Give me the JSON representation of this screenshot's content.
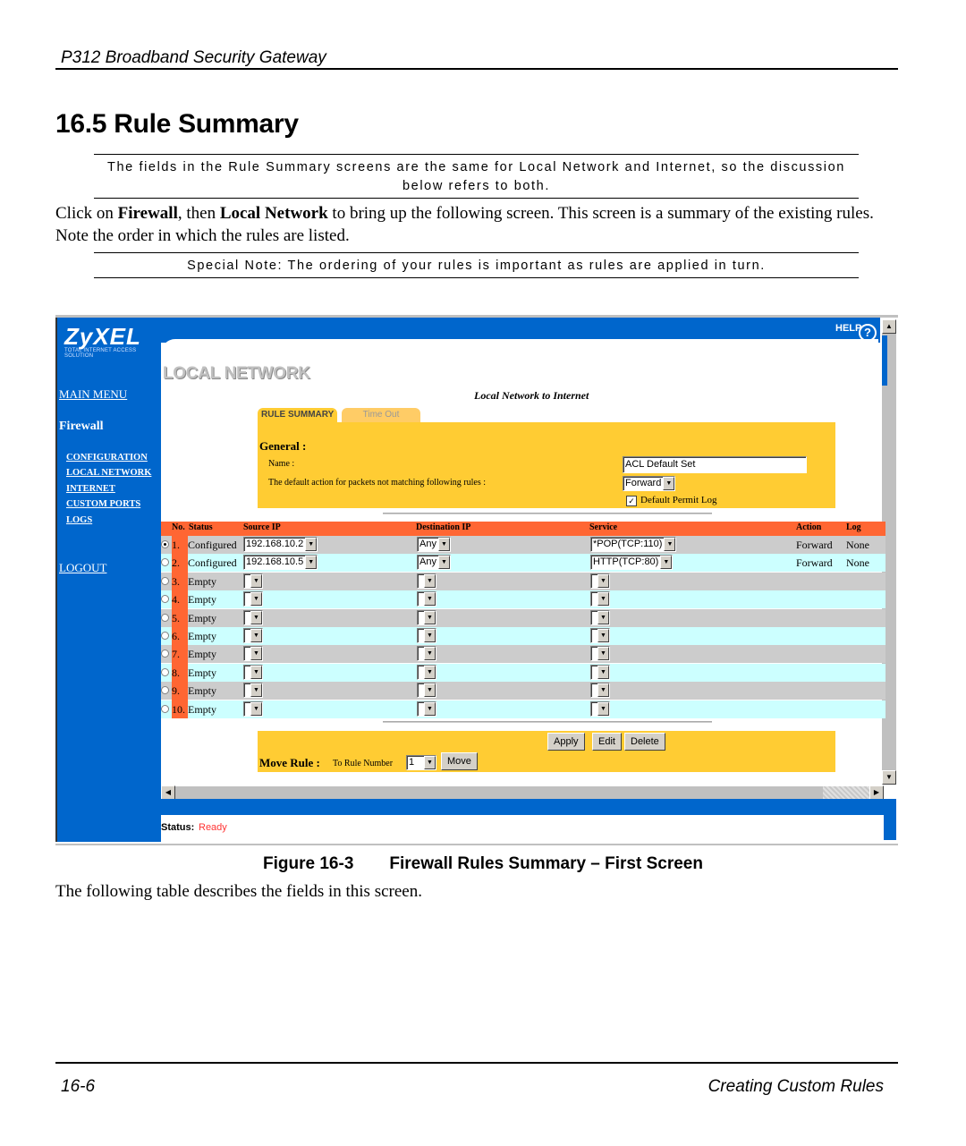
{
  "document": {
    "running_head": "P312  Broadband Security Gateway",
    "section_title": "16.5 Rule Summary",
    "note1": "The fields in the Rule Summary screens are the same for Local Network and Internet, so the discussion below refers to both.",
    "para_parts": [
      "Click on ",
      "Firewall",
      ", then ",
      "Local Network",
      " to bring up the following screen. This screen is a summary of the existing rules. Note the order in which the rules are listed."
    ],
    "note2": "Special Note: The ordering of your rules is important as rules are applied in turn.",
    "figure_label": "Figure 16-3",
    "figure_title": "Firewall Rules Summary – First Screen",
    "after_para": "The following table describes the fields in this screen.",
    "footer_left": "16-6",
    "footer_right": "Creating Custom Rules"
  },
  "app": {
    "logo": "ZyXEL",
    "logo_tagline": "TOTAL INTERNET ACCESS SOLUTION",
    "help_label": "HELP",
    "help_icon": "?",
    "sidebar": {
      "main_menu": "MAIN MENU",
      "section": "Firewall",
      "links": [
        "CONFIGURATION",
        "LOCAL NETWORK",
        "INTERNET",
        "CUSTOM PORTS",
        "LOGS"
      ],
      "logout": "LOGOUT"
    },
    "page_heading": "LOCAL NETWORK",
    "subtitle": "Local Network to Internet",
    "tabs": [
      {
        "label": "RULE SUMMARY",
        "active": true
      },
      {
        "label": "Time Out",
        "active": false
      }
    ],
    "general": {
      "title": "General :",
      "name_label": "Name :",
      "name_value": "ACL Default Set",
      "default_action_label": "The default action for packets not matching following rules :",
      "default_action_value": "Forward",
      "default_permit_log_label": "Default Permit Log",
      "default_permit_log_checked": true
    },
    "table": {
      "headers": {
        "no": "No.",
        "status": "Status",
        "source_ip": "Source IP",
        "destination_ip": "Destination IP",
        "service": "Service",
        "action": "Action",
        "log": "Log"
      },
      "rows": [
        {
          "no": "1.",
          "status": "Configured",
          "source_ip": "192.168.10.2",
          "destination_ip": "Any",
          "service": "*POP(TCP:110)",
          "action": "Forward",
          "log": "None",
          "selected": true
        },
        {
          "no": "2.",
          "status": "Configured",
          "source_ip": "192.168.10.5",
          "destination_ip": "Any",
          "service": "HTTP(TCP:80)",
          "action": "Forward",
          "log": "None",
          "selected": false
        },
        {
          "no": "3.",
          "status": "Empty",
          "source_ip": "",
          "destination_ip": "",
          "service": "",
          "action": "",
          "log": "",
          "selected": false
        },
        {
          "no": "4.",
          "status": "Empty",
          "source_ip": "",
          "destination_ip": "",
          "service": "",
          "action": "",
          "log": "",
          "selected": false
        },
        {
          "no": "5.",
          "status": "Empty",
          "source_ip": "",
          "destination_ip": "",
          "service": "",
          "action": "",
          "log": "",
          "selected": false
        },
        {
          "no": "6.",
          "status": "Empty",
          "source_ip": "",
          "destination_ip": "",
          "service": "",
          "action": "",
          "log": "",
          "selected": false
        },
        {
          "no": "7.",
          "status": "Empty",
          "source_ip": "",
          "destination_ip": "",
          "service": "",
          "action": "",
          "log": "",
          "selected": false
        },
        {
          "no": "8.",
          "status": "Empty",
          "source_ip": "",
          "destination_ip": "",
          "service": "",
          "action": "",
          "log": "",
          "selected": false
        },
        {
          "no": "9.",
          "status": "Empty",
          "source_ip": "",
          "destination_ip": "",
          "service": "",
          "action": "",
          "log": "",
          "selected": false
        },
        {
          "no": "10.",
          "status": "Empty",
          "source_ip": "",
          "destination_ip": "",
          "service": "",
          "action": "",
          "log": "",
          "selected": false
        }
      ]
    },
    "buttons": {
      "apply": "Apply",
      "edit": "Edit",
      "delete": "Delete",
      "move": "Move"
    },
    "move_rule": {
      "label": "Move Rule :",
      "sub_label": "To Rule Number",
      "value": "1"
    },
    "status": {
      "label": "Status:",
      "value": "Ready"
    },
    "colors": {
      "brand_blue": "#0066cc",
      "panel_yellow": "#ffcc33",
      "header_orange": "#ff6633",
      "row_gray": "#cccccc",
      "row_cyan": "#ccffff",
      "status_red": "#ff3333"
    }
  }
}
